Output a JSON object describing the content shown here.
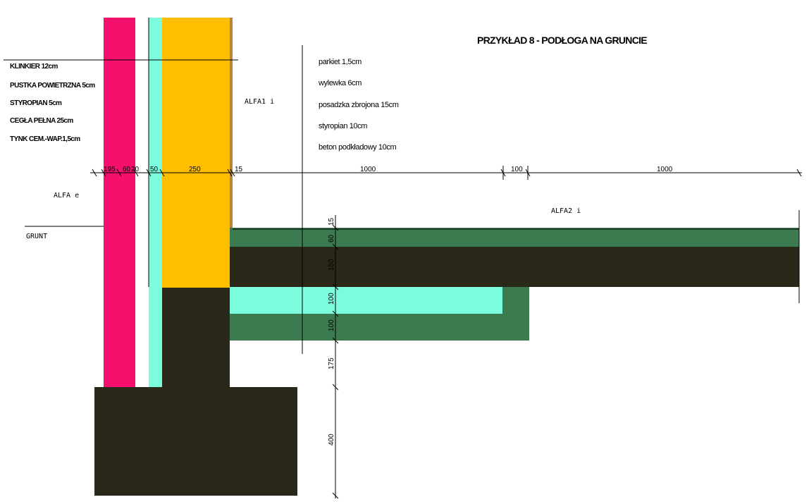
{
  "title": "PRZYKŁAD 8 - PODŁOGA NA GRUNCIE",
  "wall_layers": [
    "KLINKIER 12cm",
    "PUSTKA POWIETRZNA 5cm",
    "STYROPIAN 5cm",
    "CEGŁA PEŁNA 25cm",
    "TYNK CEM.-WAP.1,5cm"
  ],
  "floor_layers": [
    "parkiet 1,5cm",
    "wylewka 6cm",
    "posadzka zbrojona 15cm",
    "styropian 10cm",
    "beton podkładowy 10cm"
  ],
  "labels": {
    "alfa1_i": "ALFA1 i",
    "alfa_e": "ALFA e",
    "alfa2_i": "ALFA2 i",
    "grunt": "GRUNT"
  },
  "horizontal_dimensions": [
    "195",
    "60",
    "20",
    "50",
    "250",
    "15",
    "1000",
    "100",
    "1000"
  ],
  "vertical_dimensions": [
    "15",
    "60",
    "150",
    "100",
    "100",
    "175",
    "400"
  ],
  "colors": {
    "klinkier": "#f5106e",
    "styropian": "#7cfcdc",
    "cegla": "#ffbf00",
    "tynk": "#b8862e",
    "beton": "#2a2819",
    "green_layer": "#3c7b50"
  }
}
